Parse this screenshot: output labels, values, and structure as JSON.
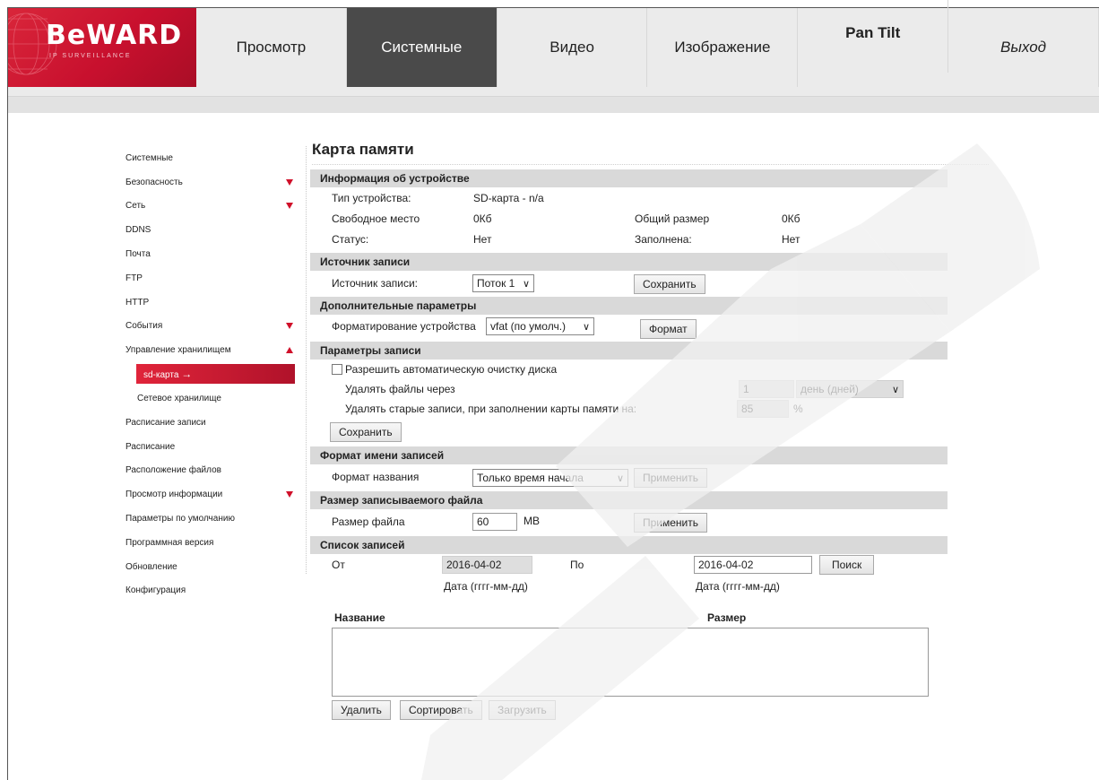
{
  "brand": {
    "name": "BeWARD",
    "tagline": "IP SURVEILLANCE"
  },
  "nav": [
    {
      "label": "Просмотр",
      "style": "normal"
    },
    {
      "label": "Системные",
      "style": "active"
    },
    {
      "label": "Видео",
      "style": "normal"
    },
    {
      "label": "Изображение",
      "style": "normal"
    },
    {
      "label": "Pan Tilt",
      "style": "bold"
    },
    {
      "label": "Выход",
      "style": "italic"
    }
  ],
  "sidebar": [
    {
      "label": "Системные"
    },
    {
      "label": "Безопасность",
      "arrow": "down"
    },
    {
      "label": "Сеть",
      "arrow": "down"
    },
    {
      "label": "DDNS"
    },
    {
      "label": "Почта"
    },
    {
      "label": "FTP"
    },
    {
      "label": "HTTP"
    },
    {
      "label": "События",
      "arrow": "down"
    },
    {
      "label": "Управление хранилищем",
      "arrow": "up"
    },
    {
      "label": "sd-карта",
      "active": true,
      "arrow_glyph": "→"
    },
    {
      "label": "Сетевое хранилище",
      "sub": true
    },
    {
      "label": "Расписание записи"
    },
    {
      "label": "Расписание"
    },
    {
      "label": "Расположение файлов"
    },
    {
      "label": "Просмотр информации",
      "arrow": "down"
    },
    {
      "label": "Параметры по умолчанию"
    },
    {
      "label": "Программная версия"
    },
    {
      "label": "Обновление"
    },
    {
      "label": "Конфигурация"
    }
  ],
  "page_title": "Карта памяти",
  "device_info": {
    "heading": "Информация об устройстве",
    "type_label": "Тип устройства:",
    "type_value": "SD-карта - n/a",
    "free_label": "Свободное место",
    "free_value": "0Кб",
    "total_label": "Общий размер",
    "total_value": "0Кб",
    "status_label": "Статус:",
    "status_value": "Нет",
    "full_label": "Заполнена:",
    "full_value": "Нет"
  },
  "record_source": {
    "heading": "Источник записи",
    "label": "Источник записи:",
    "value": "Поток 1",
    "save": "Сохранить"
  },
  "extra": {
    "heading": "Дополнительные параметры",
    "label": "Форматирование устройства",
    "value": "vfat (по умолч.)",
    "format": "Формат"
  },
  "record_params": {
    "heading": "Параметры записи",
    "auto_clean": "Разрешить автоматическую очистку диска",
    "delete_after_label": "Удалять файлы через",
    "delete_after_value": "1",
    "delete_after_unit": "день (дней)",
    "delete_old_label": "Удалять старые записи, при заполнении карты памяти на:",
    "delete_old_value": "85",
    "percent": "%",
    "save": "Сохранить"
  },
  "name_format": {
    "heading": "Формат имени записей",
    "label": "Формат названия",
    "value": "Только время начала",
    "apply": "Применить"
  },
  "file_size": {
    "heading": "Размер записываемого файла",
    "label": "Размер файла",
    "value": "60",
    "unit": "MB",
    "apply": "Применить"
  },
  "record_list": {
    "heading": "Список записей",
    "from_label": "От",
    "from_value": "2016-04-02",
    "to_label": "По",
    "to_value": "2016-04-02",
    "date_hint": "Дата (гггг-мм-дд)",
    "search": "Поиск",
    "col_name": "Название",
    "col_size": "Размер",
    "delete": "Удалить",
    "sort": "Сортировать",
    "download": "Загрузить"
  },
  "colors": {
    "brand_red": "#c8102e",
    "nav_active": "#4a4a4a",
    "section_bg": "#d9d9d9"
  }
}
